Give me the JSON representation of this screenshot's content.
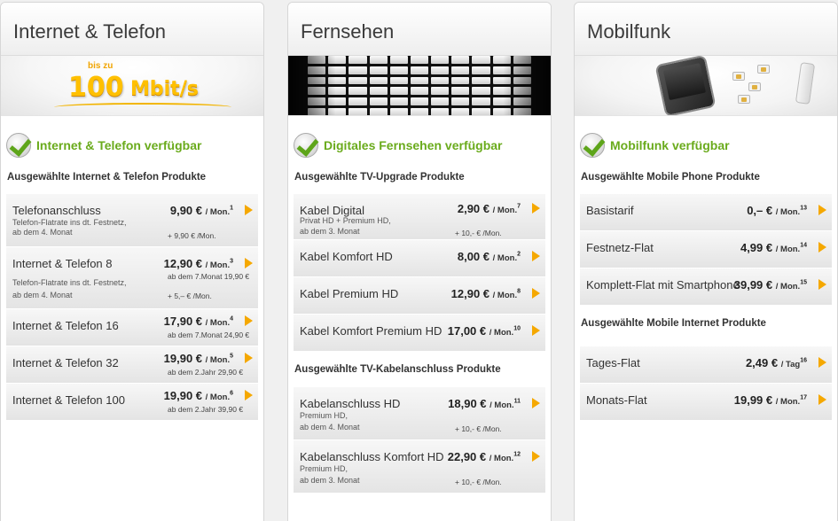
{
  "columns": [
    {
      "title": "Internet & Telefon",
      "banner": {
        "speed_prefix": "bis zu",
        "speed_value": "100",
        "speed_unit": "Mbit/s"
      },
      "availability": "Internet & Telefon verfügbar",
      "sections": [
        {
          "heading": "Ausgewählte Internet & Telefon Produkte",
          "products": [
            {
              "name": "Telefonanschluss",
              "price": "9,90 €",
              "unit": "/ Mon.",
              "footnote": "1",
              "sub": [
                "Telefon-Flatrate ins dt. Festnetz,",
                "ab dem 4. Monat"
              ],
              "after": [
                "",
                "+ 9,90 € /Mon."
              ]
            },
            {
              "name": "Internet & Telefon 8",
              "price": "12,90 €",
              "unit": "/ Mon.",
              "footnote": "3",
              "sub": [
                "Telefon-Flatrate ins dt. Festnetz,",
                "ab dem 4. Monat"
              ],
              "after": [
                "ab dem 7.Monat 19,90 €",
                "+ 5,– € /Mon."
              ]
            },
            {
              "name": "Internet & Telefon 16",
              "price": "17,90 €",
              "unit": "/ Mon.",
              "footnote": "4",
              "sub": [],
              "after": [
                "ab dem 7.Monat 24,90 €"
              ]
            },
            {
              "name": "Internet & Telefon 32",
              "price": "19,90 €",
              "unit": "/ Mon.",
              "footnote": "5",
              "sub": [],
              "after": [
                "ab dem 2.Jahr 29,90 €"
              ]
            },
            {
              "name": "Internet & Telefon 100",
              "price": "19,90 €",
              "unit": "/ Mon.",
              "footnote": "6",
              "sub": [],
              "after": [
                "ab dem 2.Jahr 39,90 €"
              ]
            }
          ]
        }
      ]
    },
    {
      "title": "Fernsehen",
      "availability": "Digitales Fernsehen verfügbar",
      "sections": [
        {
          "heading": "Ausgewählte TV-Upgrade Produkte",
          "products": [
            {
              "name": "Kabel Digital",
              "price": "2,90 €",
              "unit": "/ Mon.",
              "footnote": "7",
              "sub": [
                "Privat HD + Premium HD,",
                "ab dem 3. Monat"
              ],
              "after": [
                "+ 10,- € /Mon."
              ]
            },
            {
              "name": "Kabel Komfort HD",
              "price": "8,00 €",
              "unit": "/ Mon.",
              "footnote": "2",
              "sub": [],
              "after": []
            },
            {
              "name": "Kabel Premium HD",
              "price": "12,90 €",
              "unit": "/ Mon.",
              "footnote": "8",
              "sub": [],
              "after": []
            },
            {
              "name": "Kabel Komfort Premium HD",
              "price": "17,00 €",
              "unit": "/ Mon.",
              "footnote": "10",
              "sub": [],
              "after": []
            }
          ]
        },
        {
          "heading": "Ausgewählte TV-Kabelanschluss Produkte",
          "products": [
            {
              "name": "Kabelanschluss HD",
              "price": "18,90 €",
              "unit": "/ Mon.",
              "footnote": "11",
              "sub": [
                "Premium HD,",
                "ab dem 4. Monat"
              ],
              "after": [
                "+ 10,- € /Mon."
              ]
            },
            {
              "name": "Kabelanschluss Komfort HD",
              "price": "22,90 €",
              "unit": "/ Mon.",
              "footnote": "12",
              "sub": [
                "Premium HD,",
                "ab dem 3. Monat"
              ],
              "after": [
                "+ 10,- € /Mon."
              ]
            }
          ]
        }
      ]
    },
    {
      "title": "Mobilfunk",
      "availability": "Mobilfunk verfügbar",
      "sections": [
        {
          "heading": "Ausgewählte Mobile Phone Produkte",
          "products": [
            {
              "name": "Basistarif",
              "price": "0,– €",
              "unit": "/ Mon.",
              "footnote": "13",
              "sub": [],
              "after": []
            },
            {
              "name": "Festnetz-Flat",
              "price": "4,99 €",
              "unit": "/ Mon.",
              "footnote": "14",
              "sub": [],
              "after": []
            },
            {
              "name": "Komplett-Flat mit Smartphone",
              "price": "39,99 €",
              "unit": "/ Mon.",
              "footnote": "15",
              "sub": [],
              "after": []
            }
          ]
        },
        {
          "heading": "Ausgewählte Mobile Internet Produkte",
          "products": [
            {
              "name": "Tages-Flat",
              "price": "2,49 €",
              "unit": "/ Tag",
              "footnote": "16",
              "sub": [],
              "after": []
            },
            {
              "name": "Monats-Flat",
              "price": "19,99 €",
              "unit": "/ Mon.",
              "footnote": "17",
              "sub": [],
              "after": []
            }
          ]
        }
      ]
    }
  ],
  "colors": {
    "accent_green": "#6aab1c",
    "arrow_orange": "#f5a800",
    "speed_yellow": "#ffc000"
  },
  "icons": {
    "availability": "checkmark-icon",
    "product_link": "chevron-right-icon"
  }
}
